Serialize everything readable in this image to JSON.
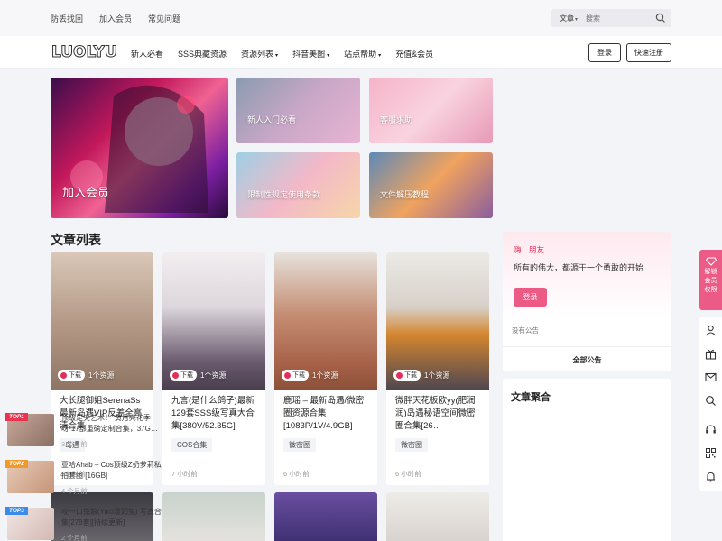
{
  "topbar": {
    "links": [
      "防丢找回",
      "加入会员",
      "常见问题"
    ],
    "search_type": "文章",
    "search_placeholder": "搜索"
  },
  "nav": {
    "logo": "LUOLYU",
    "items": [
      "新人必看",
      "SSS典藏资源",
      "资源列表",
      "抖音美图",
      "站点帮助",
      "充值&会员"
    ],
    "login": "登录",
    "register": "快速注册"
  },
  "banners": {
    "main": "加入会员",
    "b1": "新人入门必看",
    "b2": "客服求助",
    "b3": "限制性规定使用条款",
    "b4": "文件解压教程"
  },
  "section_title": "文章列表",
  "cards": [
    {
      "title": "大长腿御姐SerenaSs最新岛遇VIP反差全高清合集",
      "category": "岛遇",
      "time": "7 小时前",
      "download": "下载",
      "resources": "1个资源"
    },
    {
      "title": "九言(是什么鸽子)最新129套SSS级写真大合集[380V/52.35G]",
      "category": "COS合集",
      "time": "7 小时前",
      "download": "下载",
      "resources": "1个资源"
    },
    {
      "title": "鹿瑶 – 最新岛遇/微密圈资源合集[1083P/1V/4.9GB]",
      "category": "微密圈",
      "time": "6 小时前",
      "download": "下载",
      "resources": "1个资源"
    },
    {
      "title": "微胖天花板欧yy(肥润润)岛遇秘语空间微密圈合集[26…",
      "category": "微密圈",
      "time": "6 小时前",
      "download": "下载",
      "resources": "1个资源"
    }
  ],
  "welcome": {
    "hi": "嗨！朋友",
    "message": "所有的伟大，都源于一个勇敢的开始",
    "login": "登录",
    "notice": "没有公告",
    "all_notices": "全部公告"
  },
  "aggregation": {
    "title": "文章聚合",
    "items": [
      {
        "badge": "TOP1",
        "title": "顶级足尖艺术！\"黄月亮花季呀\"17部重磅定制合集，37G…",
        "time": "3 个月前"
      },
      {
        "badge": "TOP2",
        "title": "亚哈Ahab – Cos顶级Z奶萝莉私拍套图 [16GB]",
        "time": "4 个月前"
      },
      {
        "badge": "TOP3",
        "title": "咬一口兔娘(Yiko湿润兔) 写真合集[278套][持续更新]",
        "time": "2 个月前"
      }
    ]
  },
  "float": {
    "vip_label": "解锁会员权限"
  },
  "colors": {
    "accent": "#ec5b86",
    "top1": "#e8344e",
    "top2": "#f19a2c",
    "top3": "#3b8be8"
  }
}
